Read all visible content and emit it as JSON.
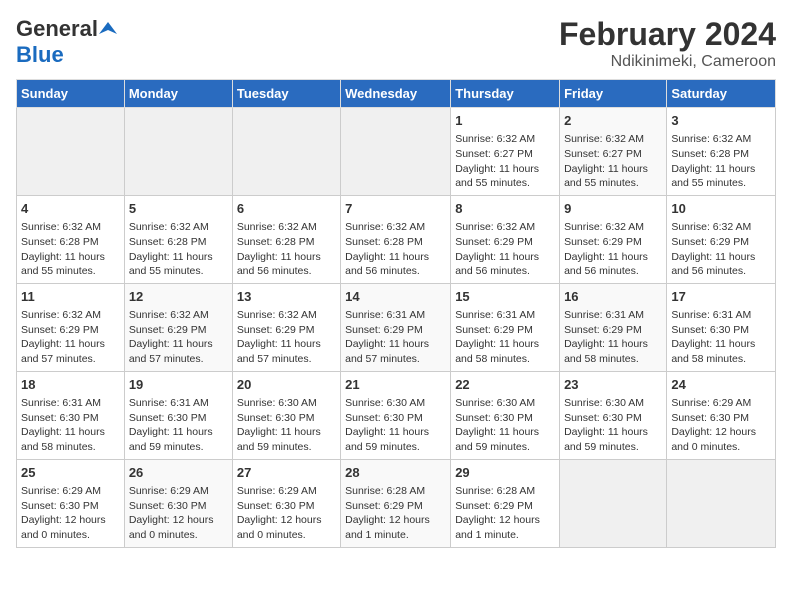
{
  "logo": {
    "general": "General",
    "blue": "Blue"
  },
  "title": "February 2024",
  "subtitle": "Ndikinimeki, Cameroon",
  "days_of_week": [
    "Sunday",
    "Monday",
    "Tuesday",
    "Wednesday",
    "Thursday",
    "Friday",
    "Saturday"
  ],
  "weeks": [
    [
      {
        "day": "",
        "info": ""
      },
      {
        "day": "",
        "info": ""
      },
      {
        "day": "",
        "info": ""
      },
      {
        "day": "",
        "info": ""
      },
      {
        "day": "1",
        "info": "Sunrise: 6:32 AM\nSunset: 6:27 PM\nDaylight: 11 hours\nand 55 minutes."
      },
      {
        "day": "2",
        "info": "Sunrise: 6:32 AM\nSunset: 6:27 PM\nDaylight: 11 hours\nand 55 minutes."
      },
      {
        "day": "3",
        "info": "Sunrise: 6:32 AM\nSunset: 6:28 PM\nDaylight: 11 hours\nand 55 minutes."
      }
    ],
    [
      {
        "day": "4",
        "info": "Sunrise: 6:32 AM\nSunset: 6:28 PM\nDaylight: 11 hours\nand 55 minutes."
      },
      {
        "day": "5",
        "info": "Sunrise: 6:32 AM\nSunset: 6:28 PM\nDaylight: 11 hours\nand 55 minutes."
      },
      {
        "day": "6",
        "info": "Sunrise: 6:32 AM\nSunset: 6:28 PM\nDaylight: 11 hours\nand 56 minutes."
      },
      {
        "day": "7",
        "info": "Sunrise: 6:32 AM\nSunset: 6:28 PM\nDaylight: 11 hours\nand 56 minutes."
      },
      {
        "day": "8",
        "info": "Sunrise: 6:32 AM\nSunset: 6:29 PM\nDaylight: 11 hours\nand 56 minutes."
      },
      {
        "day": "9",
        "info": "Sunrise: 6:32 AM\nSunset: 6:29 PM\nDaylight: 11 hours\nand 56 minutes."
      },
      {
        "day": "10",
        "info": "Sunrise: 6:32 AM\nSunset: 6:29 PM\nDaylight: 11 hours\nand 56 minutes."
      }
    ],
    [
      {
        "day": "11",
        "info": "Sunrise: 6:32 AM\nSunset: 6:29 PM\nDaylight: 11 hours\nand 57 minutes."
      },
      {
        "day": "12",
        "info": "Sunrise: 6:32 AM\nSunset: 6:29 PM\nDaylight: 11 hours\nand 57 minutes."
      },
      {
        "day": "13",
        "info": "Sunrise: 6:32 AM\nSunset: 6:29 PM\nDaylight: 11 hours\nand 57 minutes."
      },
      {
        "day": "14",
        "info": "Sunrise: 6:31 AM\nSunset: 6:29 PM\nDaylight: 11 hours\nand 57 minutes."
      },
      {
        "day": "15",
        "info": "Sunrise: 6:31 AM\nSunset: 6:29 PM\nDaylight: 11 hours\nand 58 minutes."
      },
      {
        "day": "16",
        "info": "Sunrise: 6:31 AM\nSunset: 6:29 PM\nDaylight: 11 hours\nand 58 minutes."
      },
      {
        "day": "17",
        "info": "Sunrise: 6:31 AM\nSunset: 6:30 PM\nDaylight: 11 hours\nand 58 minutes."
      }
    ],
    [
      {
        "day": "18",
        "info": "Sunrise: 6:31 AM\nSunset: 6:30 PM\nDaylight: 11 hours\nand 58 minutes."
      },
      {
        "day": "19",
        "info": "Sunrise: 6:31 AM\nSunset: 6:30 PM\nDaylight: 11 hours\nand 59 minutes."
      },
      {
        "day": "20",
        "info": "Sunrise: 6:30 AM\nSunset: 6:30 PM\nDaylight: 11 hours\nand 59 minutes."
      },
      {
        "day": "21",
        "info": "Sunrise: 6:30 AM\nSunset: 6:30 PM\nDaylight: 11 hours\nand 59 minutes."
      },
      {
        "day": "22",
        "info": "Sunrise: 6:30 AM\nSunset: 6:30 PM\nDaylight: 11 hours\nand 59 minutes."
      },
      {
        "day": "23",
        "info": "Sunrise: 6:30 AM\nSunset: 6:30 PM\nDaylight: 11 hours\nand 59 minutes."
      },
      {
        "day": "24",
        "info": "Sunrise: 6:29 AM\nSunset: 6:30 PM\nDaylight: 12 hours\nand 0 minutes."
      }
    ],
    [
      {
        "day": "25",
        "info": "Sunrise: 6:29 AM\nSunset: 6:30 PM\nDaylight: 12 hours\nand 0 minutes."
      },
      {
        "day": "26",
        "info": "Sunrise: 6:29 AM\nSunset: 6:30 PM\nDaylight: 12 hours\nand 0 minutes."
      },
      {
        "day": "27",
        "info": "Sunrise: 6:29 AM\nSunset: 6:30 PM\nDaylight: 12 hours\nand 0 minutes."
      },
      {
        "day": "28",
        "info": "Sunrise: 6:28 AM\nSunset: 6:29 PM\nDaylight: 12 hours\nand 1 minute."
      },
      {
        "day": "29",
        "info": "Sunrise: 6:28 AM\nSunset: 6:29 PM\nDaylight: 12 hours\nand 1 minute."
      },
      {
        "day": "",
        "info": ""
      },
      {
        "day": "",
        "info": ""
      }
    ]
  ]
}
